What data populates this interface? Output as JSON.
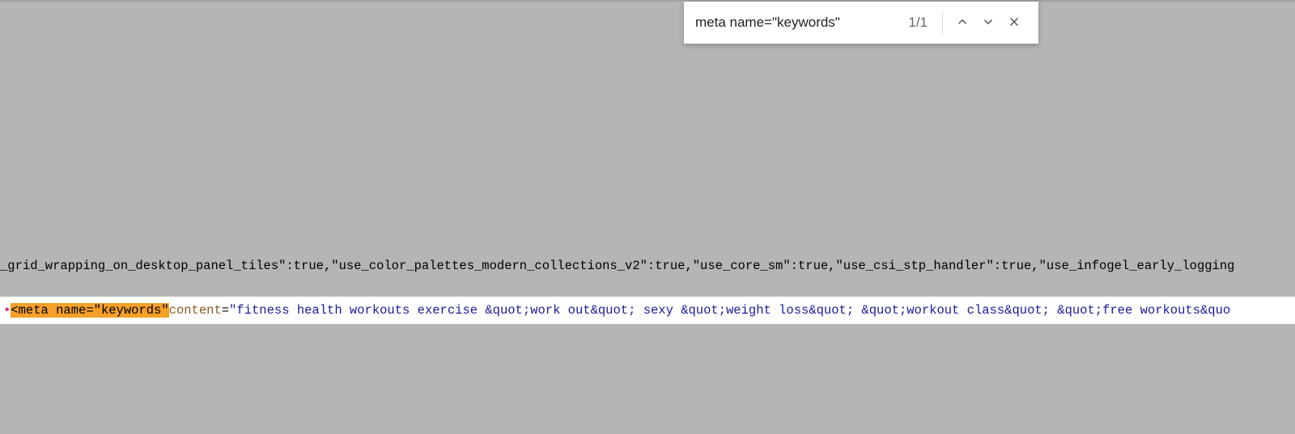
{
  "find": {
    "query": "meta name=\"keywords\"",
    "count": "1/1"
  },
  "source": {
    "line1": "_grid_wrapping_on_desktop_panel_tiles\":true,\"use_color_palettes_modern_collections_v2\":true,\"use_core_sm\":true,\"use_csi_stp_handler\":true,\"use_infogel_early_logging",
    "line2": {
      "prefix_dot": "•",
      "open_bracket": "<",
      "highlighted": "meta name=\"keywords\"",
      "content_attr": " content",
      "equals": "=",
      "quote": "\"",
      "content_value": "fitness health workouts exercise &quot;work out&quot; sexy &quot;weight loss&quot; &quot;workout class&quot; &quot;free workouts&quo"
    }
  }
}
